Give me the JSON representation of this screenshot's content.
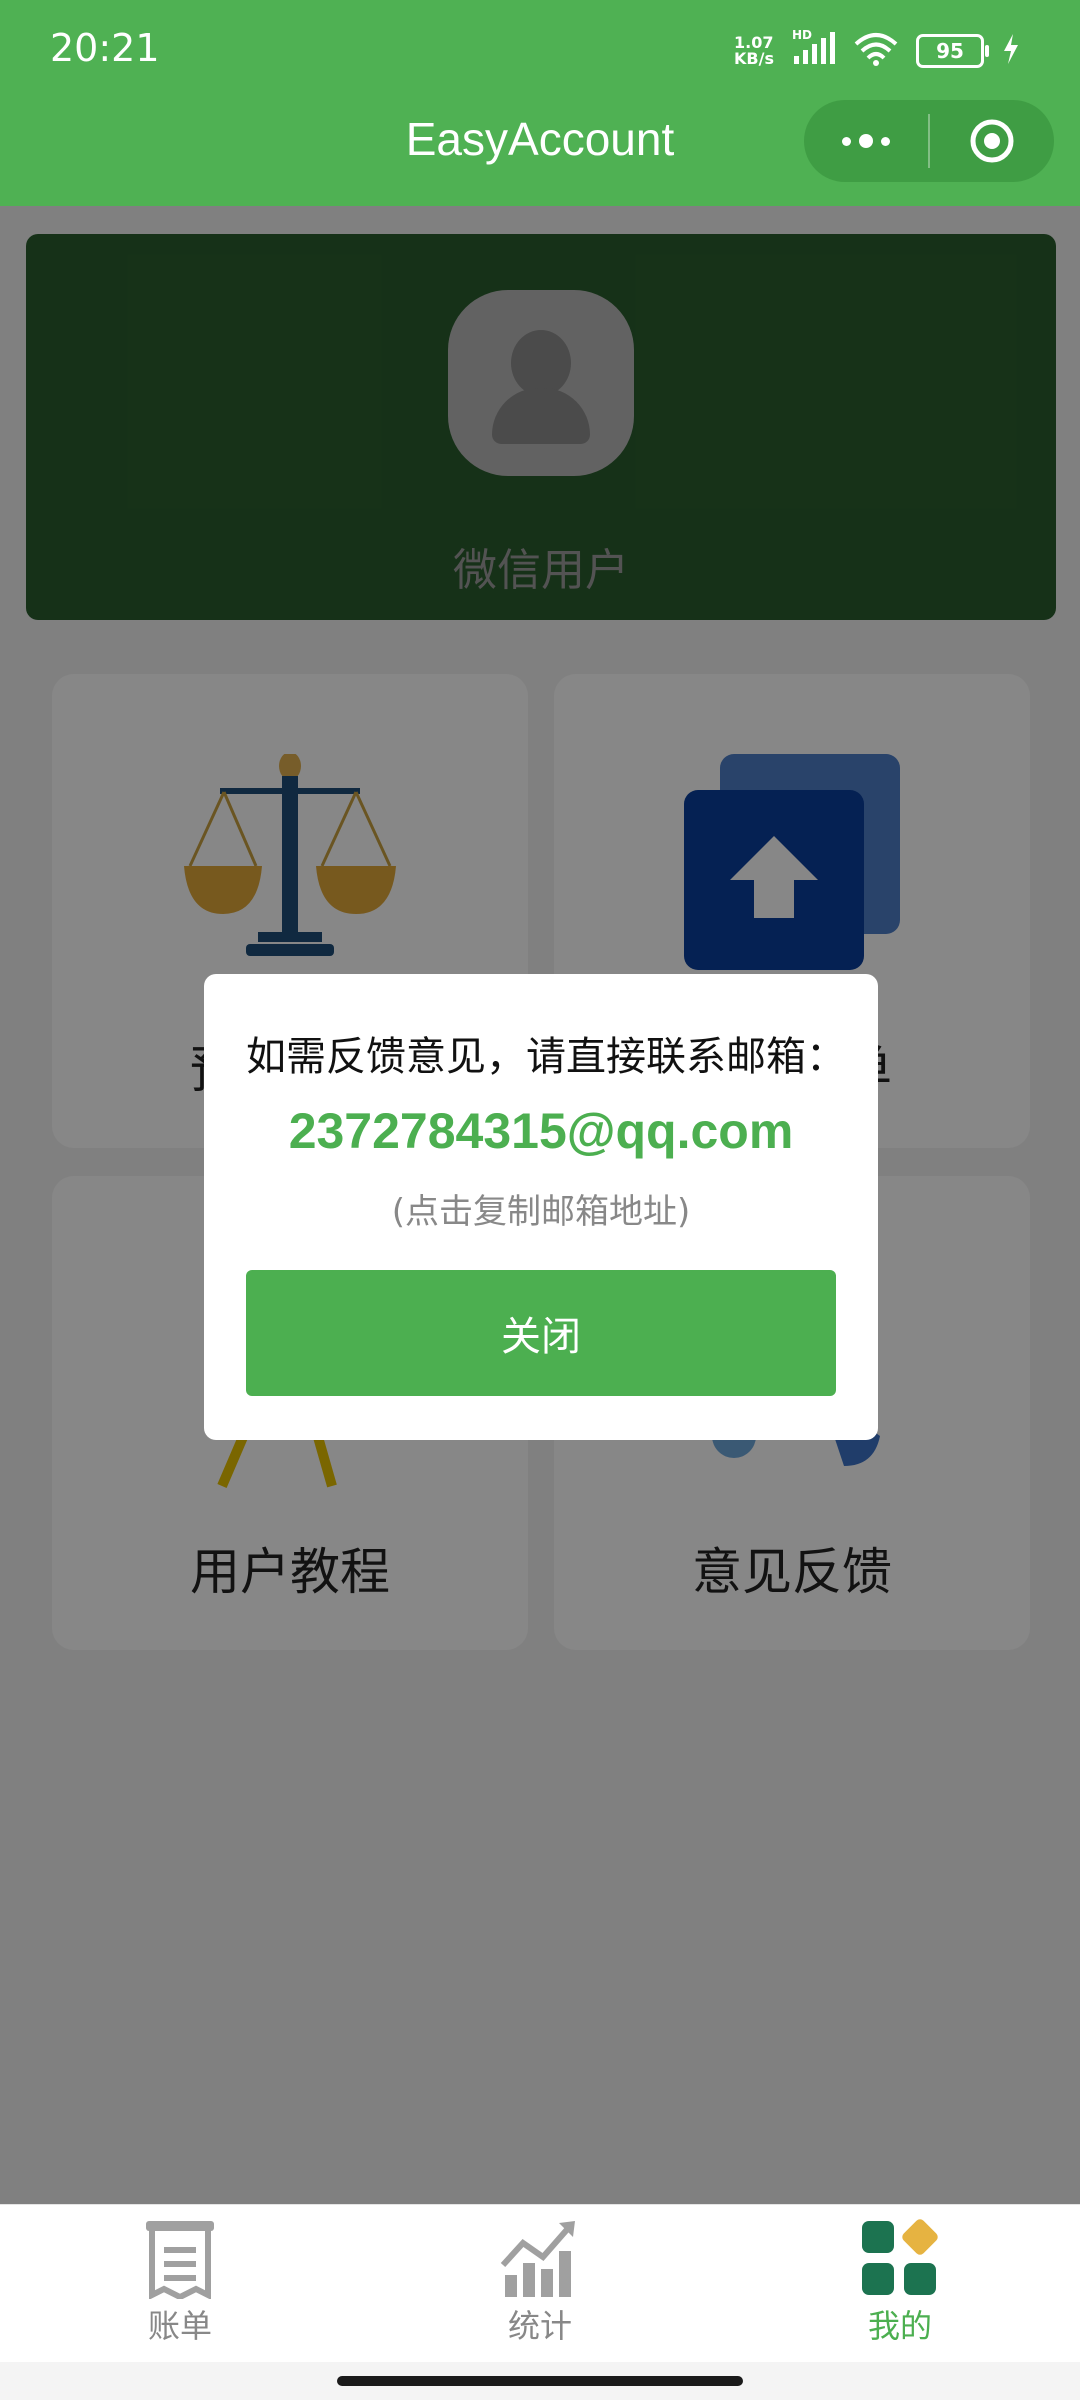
{
  "status_bar": {
    "time": "20:21",
    "net_speed_value": "1.07",
    "net_speed_unit": "KB/s",
    "network_badge": "HD",
    "battery": "95"
  },
  "header": {
    "title": "EasyAccount"
  },
  "profile": {
    "username": "微信用户"
  },
  "tiles": [
    {
      "label": "预算设置",
      "icon": "scale-icon"
    },
    {
      "label": "导出账单",
      "icon": "upload-icon"
    },
    {
      "label": "用户教程",
      "icon": "tutorial-icon"
    },
    {
      "label": "意见反馈",
      "icon": "feedback-icon"
    }
  ],
  "dialog": {
    "message": "如需反馈意见，请直接联系邮箱：",
    "email": "2372784315@qq.com",
    "hint": "(点击复制邮箱地址)",
    "close_label": "关闭"
  },
  "tabbar": {
    "items": [
      {
        "label": "账单",
        "icon": "bill-icon",
        "active": false
      },
      {
        "label": "统计",
        "icon": "stats-icon",
        "active": false
      },
      {
        "label": "我的",
        "icon": "mine-icon",
        "active": true
      }
    ]
  },
  "colors": {
    "brand_green": "#4fb153",
    "profile_card": "#2b5e2e",
    "accent_text": "#4caf50"
  }
}
